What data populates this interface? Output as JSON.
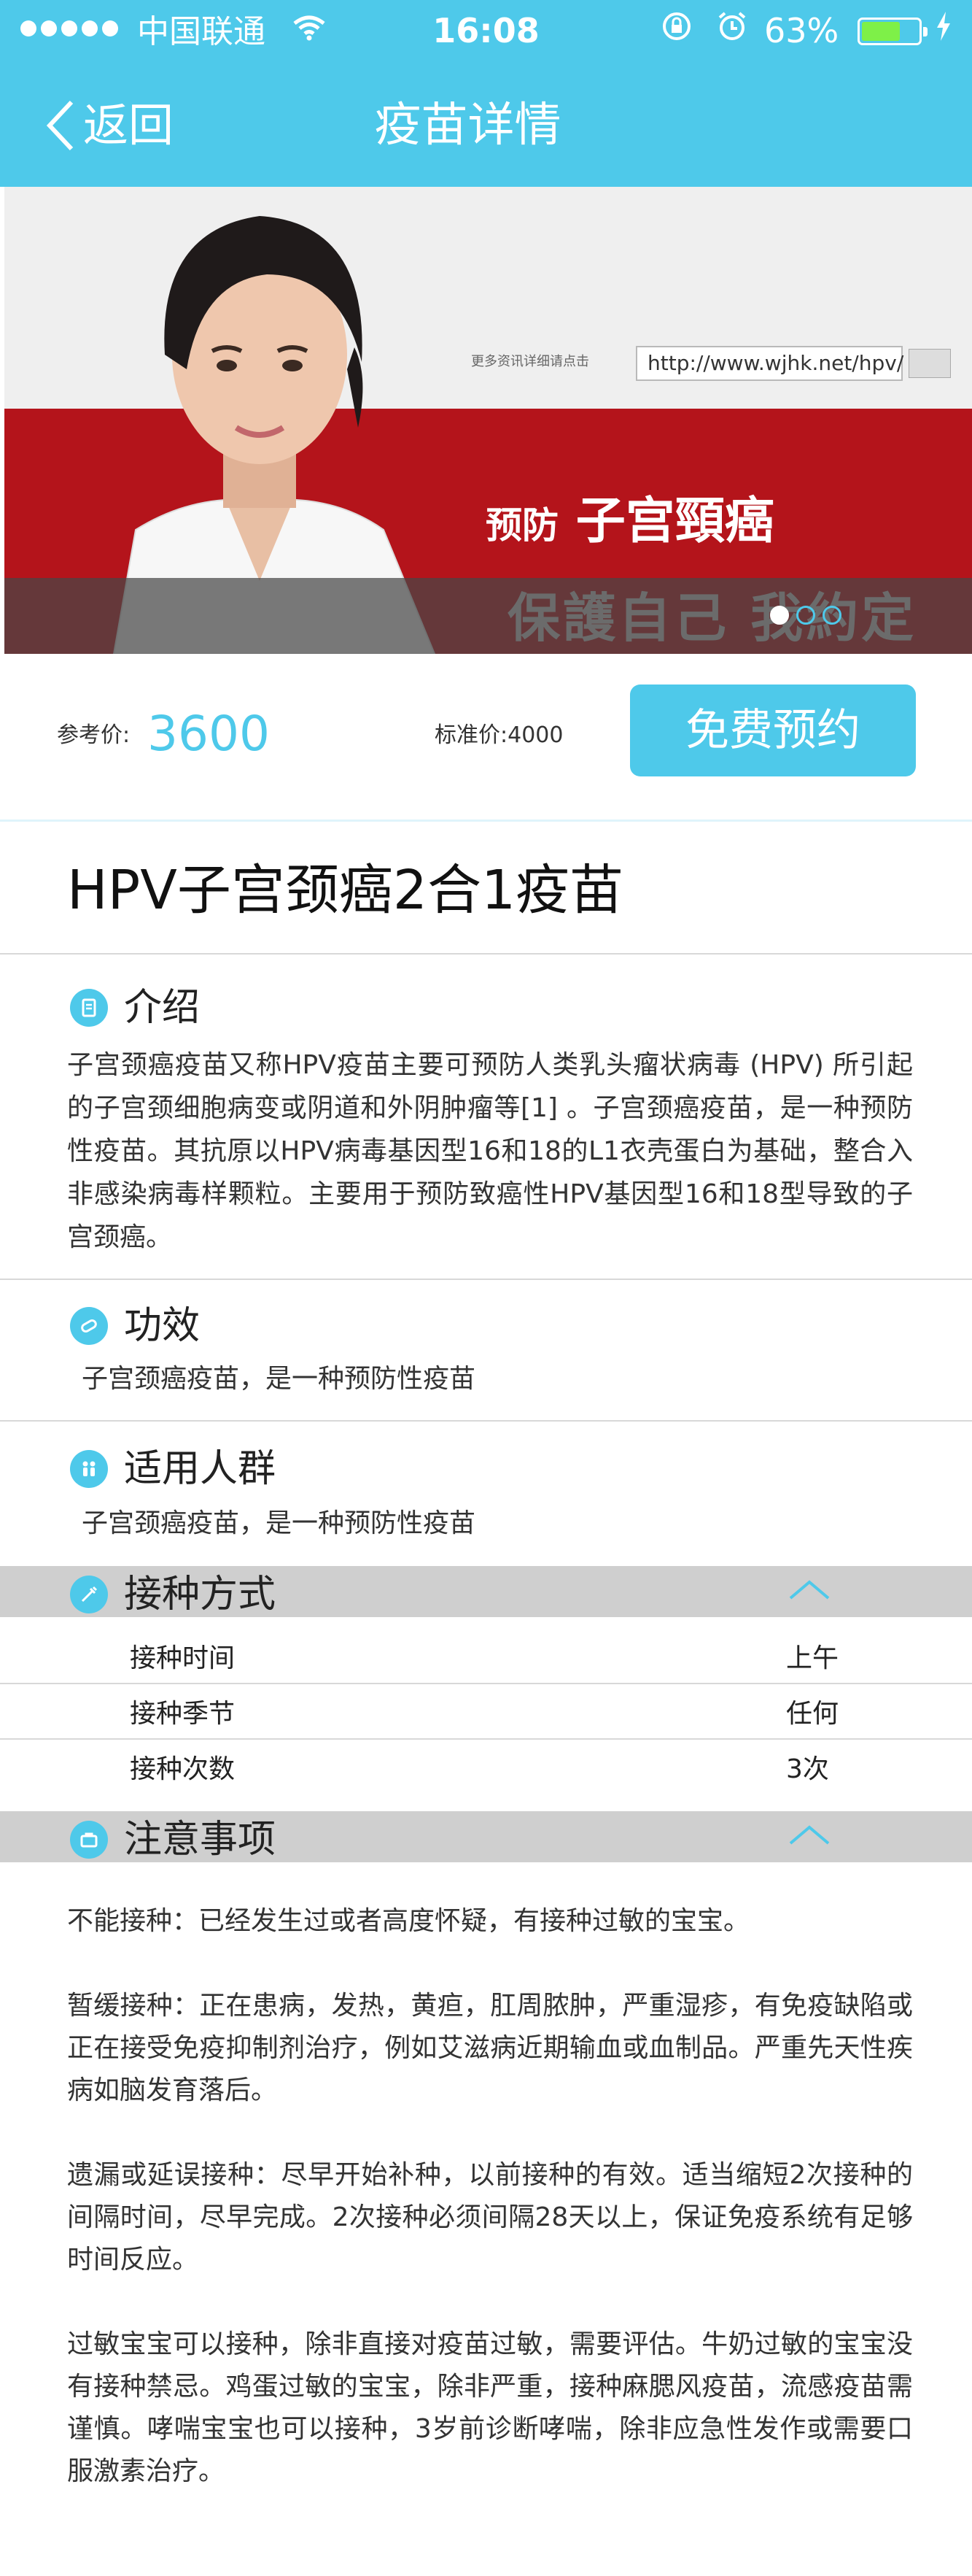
{
  "status": {
    "carrier": "中国联通",
    "time": "16:08",
    "battery_pct": "63%",
    "battery_level": 0.63,
    "icons": [
      "signal-dots-icon",
      "wifi-icon",
      "rotation-lock-icon",
      "alarm-icon",
      "battery-icon",
      "charging-bolt-icon"
    ]
  },
  "nav": {
    "back_label": "返回",
    "title": "疫苗详情"
  },
  "banner": {
    "url_text": "http://www.wjhk.net/hpv/",
    "url_hint": "更多资讯详细请点击",
    "slogan_small": "预防",
    "slogan_big": "子宫頸癌",
    "slogan_overlay": "保護自己 我約定妳",
    "dots_total": 3,
    "dots_active": 1
  },
  "price": {
    "ref_label": "参考价:",
    "ref_value": "3600",
    "std_label": "标准价:4000",
    "book_button": "免费预约"
  },
  "product_title": "HPV子宫颈癌2合1疫苗",
  "intro": {
    "heading": "介绍",
    "text": "子宫颈癌疫苗又称HPV疫苗主要可预防人类乳头瘤状病毒 (HPV) 所引起的子宫颈细胞病变或阴道和外阴肿瘤等[1] 。子宫颈癌疫苗，是一种预防性疫苗。其抗原以HPV病毒基因型16和18的L1衣壳蛋白为基础，整合入非感染病毒样颗粒。主要用于预防致癌性HPV基因型16和18型导致的子宫颈癌。"
  },
  "efficacy": {
    "heading": "功效",
    "text": "子宫颈癌疫苗，是一种预防性疫苗"
  },
  "audience": {
    "heading": "适用人群",
    "text": "子宫颈癌疫苗，是一种预防性疫苗"
  },
  "schedule": {
    "heading": "接种方式",
    "rows": [
      {
        "key": "接种时间",
        "value": "上午"
      },
      {
        "key": "接种季节",
        "value": "任何"
      },
      {
        "key": "接种次数",
        "value": "3次"
      }
    ]
  },
  "notes": {
    "heading": "注意事项",
    "paragraphs": [
      "不能接种：已经发生过或者高度怀疑，有接种过敏的宝宝。",
      "暂缓接种：正在患病，发热，黄疸，肛周脓肿，严重湿疹，有免疫缺陷或正在接受免疫抑制剂治疗，例如艾滋病近期输血或血制品。严重先天性疾病如脑发育落后。",
      "遗漏或延误接种：尽早开始补种，以前接种的有效。适当缩短2次接种的间隔时间，尽早完成。2次接种必须间隔28天以上，保证免疫系统有足够时间反应。",
      "过敏宝宝可以接种，除非直接对疫苗过敏，需要评估。牛奶过敏的宝宝没有接种禁忌。鸡蛋过敏的宝宝，除非严重，接种麻腮风疫苗，流感疫苗需谨慎。哮喘宝宝也可以接种，3岁前诊断哮喘，除非应急性发作或需要口服激素治疗。"
    ]
  },
  "colors": {
    "accent": "#4ec9ea",
    "banner_red": "#b4141b",
    "section_bar": "#cfcfcf"
  }
}
